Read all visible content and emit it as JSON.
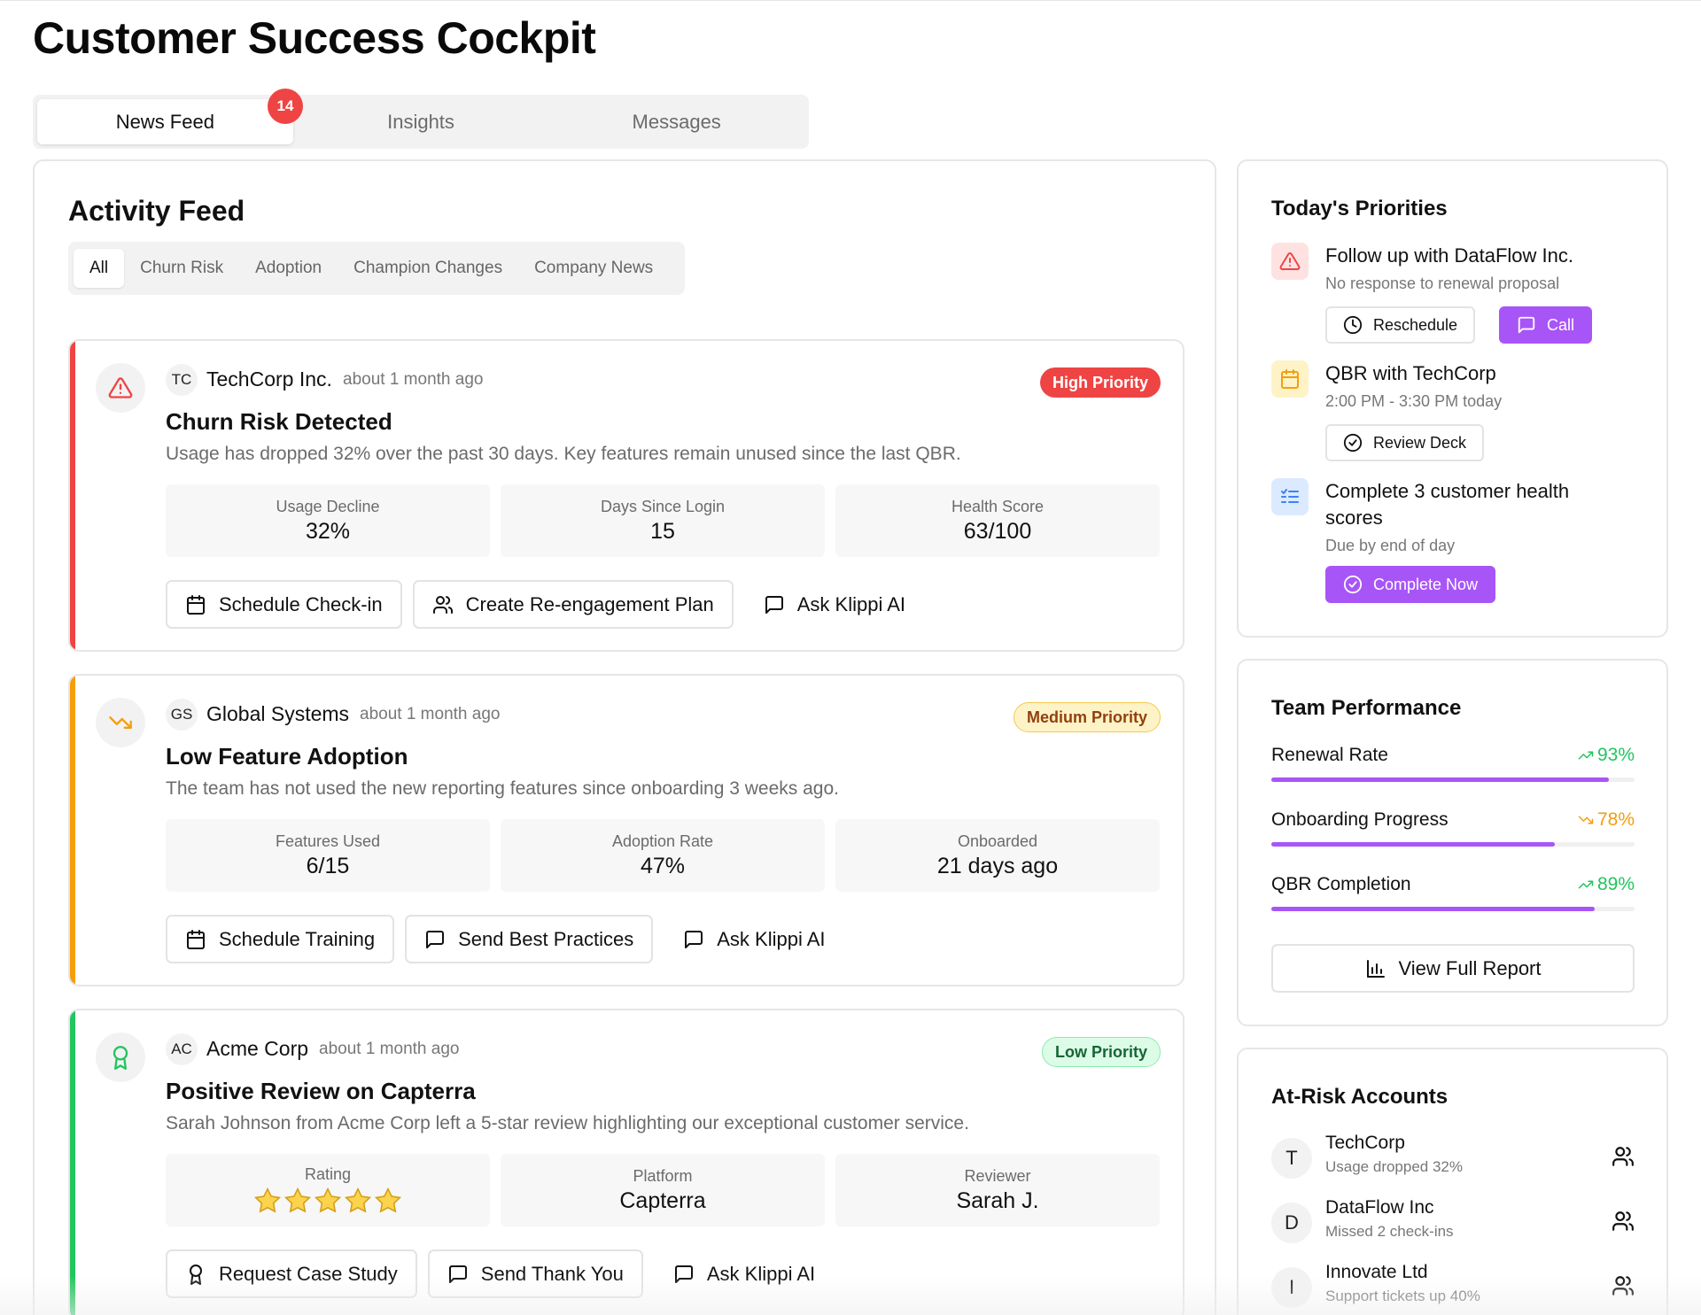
{
  "app": {
    "title": "Customer Success Cockpit"
  },
  "tabs": [
    {
      "label": "News Feed",
      "badge": "14"
    },
    {
      "label": "Insights"
    },
    {
      "label": "Messages"
    }
  ],
  "feed": {
    "title": "Activity Feed",
    "filters": [
      "All",
      "Churn Risk",
      "Adoption",
      "Champion Changes",
      "Company News"
    ],
    "items": [
      {
        "initials": "TC",
        "company": "TechCorp Inc.",
        "time": "about 1 month ago",
        "priority": "High Priority",
        "headline": "Churn Risk Detected",
        "description": "Usage has dropped 32% over the past 30 days. Key features remain unused since the last QBR.",
        "stats": [
          {
            "label": "Usage Decline",
            "value": "32%"
          },
          {
            "label": "Days Since Login",
            "value": "15"
          },
          {
            "label": "Health Score",
            "value": "63/100"
          }
        ],
        "actions": [
          "Schedule Check-in",
          "Create Re-engagement Plan",
          "Ask Klippi AI"
        ]
      },
      {
        "initials": "GS",
        "company": "Global Systems",
        "time": "about 1 month ago",
        "priority": "Medium Priority",
        "headline": "Low Feature Adoption",
        "description": "The team has not used the new reporting features since onboarding 3 weeks ago.",
        "stats": [
          {
            "label": "Features Used",
            "value": "6/15"
          },
          {
            "label": "Adoption Rate",
            "value": "47%"
          },
          {
            "label": "Onboarded",
            "value": "21 days ago"
          }
        ],
        "actions": [
          "Schedule Training",
          "Send Best Practices",
          "Ask Klippi AI"
        ]
      },
      {
        "initials": "AC",
        "company": "Acme Corp",
        "time": "about 1 month ago",
        "priority": "Low Priority",
        "headline": "Positive Review on Capterra",
        "description": "Sarah Johnson from Acme Corp left a 5-star review highlighting our exceptional customer service.",
        "stats": [
          {
            "label": "Rating",
            "stars": 5
          },
          {
            "label": "Platform",
            "value": "Capterra"
          },
          {
            "label": "Reviewer",
            "value": "Sarah J."
          }
        ],
        "actions": [
          "Request Case Study",
          "Send Thank You",
          "Ask Klippi AI"
        ]
      }
    ]
  },
  "priorities": {
    "title": "Today's Priorities",
    "items": [
      {
        "title": "Follow up with DataFlow Inc.",
        "subtitle": "No response to renewal proposal",
        "buttons": [
          "Reschedule",
          "Call"
        ]
      },
      {
        "title": "QBR with TechCorp",
        "subtitle": "2:00 PM - 3:30 PM today",
        "buttons": [
          "Review Deck"
        ]
      },
      {
        "title": "Complete 3 customer health scores",
        "subtitle": "Due by end of day",
        "buttons": [
          "Complete Now"
        ]
      }
    ]
  },
  "performance": {
    "title": "Team Performance",
    "metrics": [
      {
        "label": "Renewal Rate",
        "value": "93%",
        "fill": 0.93,
        "trend": "up",
        "color": "#22c55e"
      },
      {
        "label": "Onboarding Progress",
        "value": "78%",
        "fill": 0.78,
        "trend": "down",
        "color": "#f59e0b"
      },
      {
        "label": "QBR Completion",
        "value": "89%",
        "fill": 0.89,
        "trend": "up",
        "color": "#22c55e"
      }
    ],
    "report_button": "View Full Report"
  },
  "at_risk": {
    "title": "At-Risk Accounts",
    "accounts": [
      {
        "initial": "T",
        "name": "TechCorp",
        "detail": "Usage dropped 32%"
      },
      {
        "initial": "D",
        "name": "DataFlow Inc",
        "detail": "Missed 2 check-ins"
      },
      {
        "initial": "I",
        "name": "Innovate Ltd",
        "detail": "Support tickets up 40%"
      }
    ]
  },
  "colors": {
    "accent": "#a855f7",
    "high": "#ef4444",
    "medium": "#f59e0b",
    "low": "#22c55e"
  }
}
